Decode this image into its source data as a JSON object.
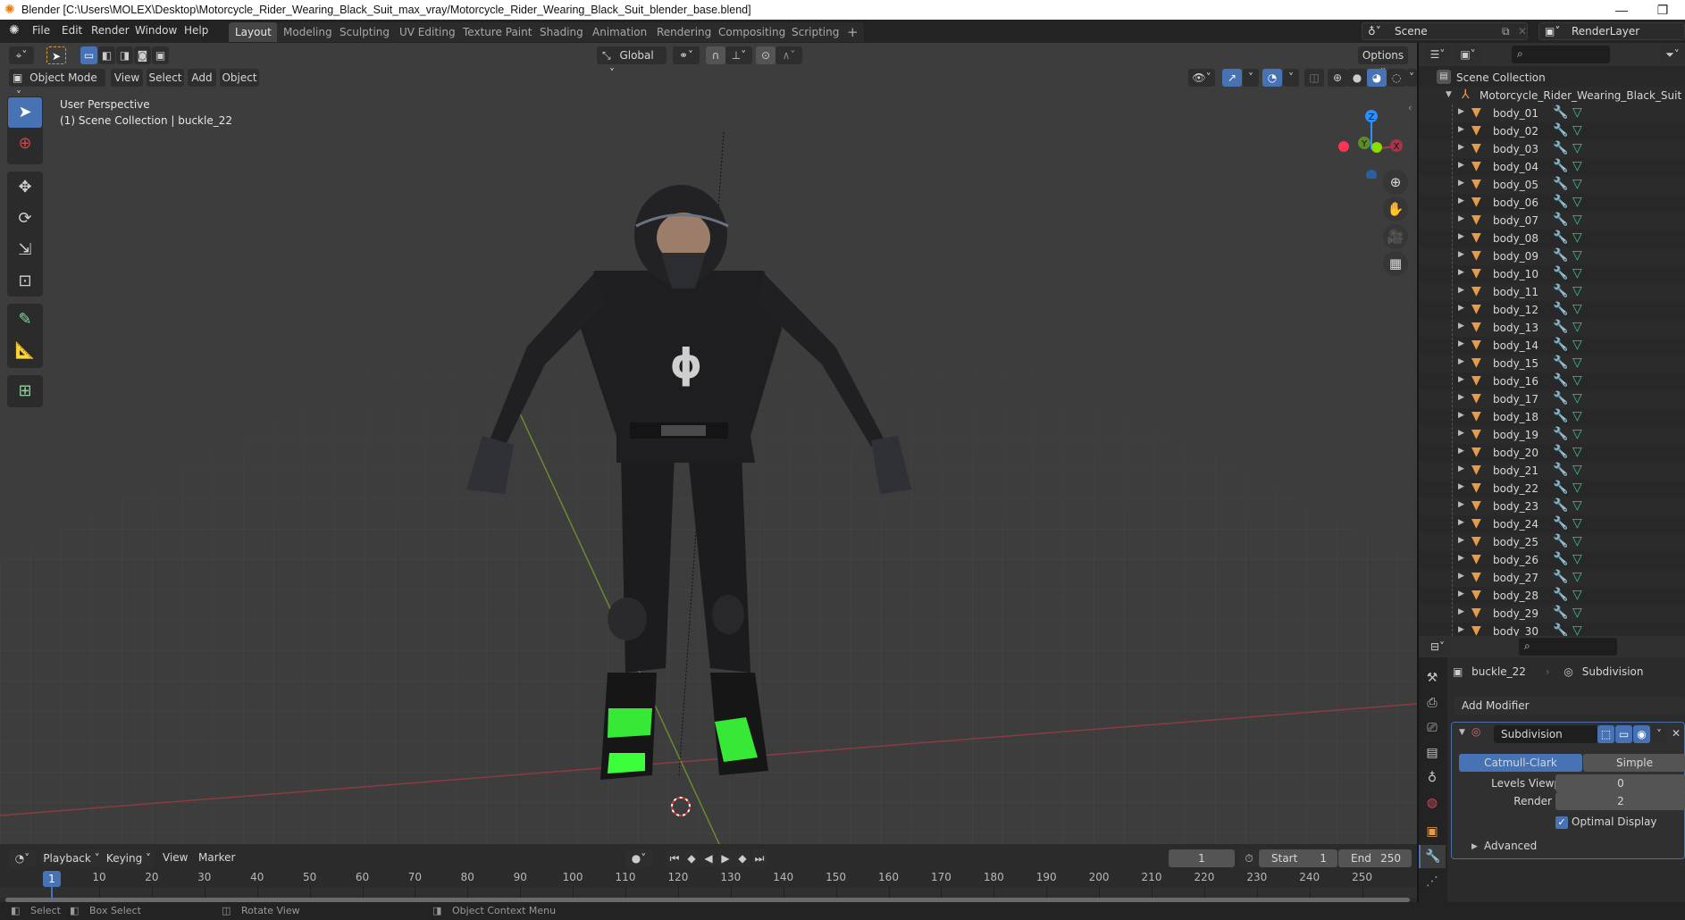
{
  "window": {
    "title": "Blender [C:\\Users\\MOLEX\\Desktop\\Motorcycle_Rider_Wearing_Black_Suit_max_vray/Motorcycle_Rider_Wearing_Black_Suit_blender_base.blend]",
    "minimize_label": "—",
    "maximize_label": "❐"
  },
  "menus": [
    "File",
    "Edit",
    "Render",
    "Window",
    "Help"
  ],
  "workspace_tabs": [
    {
      "label": "Layout",
      "active": true
    },
    {
      "label": "Modeling",
      "active": false
    },
    {
      "label": "Sculpting",
      "active": false
    },
    {
      "label": "UV Editing",
      "active": false
    },
    {
      "label": "Texture Paint",
      "active": false
    },
    {
      "label": "Shading",
      "active": false
    },
    {
      "label": "Animation",
      "active": false
    },
    {
      "label": "Rendering",
      "active": false
    },
    {
      "label": "Compositing",
      "active": false
    },
    {
      "label": "Scripting",
      "active": false
    }
  ],
  "add_workspace_label": "+",
  "scene": {
    "name": "Scene",
    "view_layer": "RenderLayer"
  },
  "viewport": {
    "transform_orientation": "Global",
    "options_label": "Options",
    "mode": "Object Mode",
    "header_menus": [
      "View",
      "Select",
      "Add",
      "Object"
    ],
    "overlay_title": "User Perspective",
    "overlay_subtitle": "(1) Scene Collection | buckle_22",
    "gizmo_axes": {
      "x": "X",
      "y": "Y",
      "z": "Z"
    },
    "colors": {
      "x_axis": "#ff3352",
      "y_axis": "#8bdc00",
      "z_axis": "#2890ff",
      "accent": "#4772b3",
      "background": "#3d3d3d"
    }
  },
  "outliner": {
    "root": "Scene Collection",
    "collection": "Motorcycle_Rider_Wearing_Black_Suit",
    "items": [
      "body_01",
      "body_02",
      "body_03",
      "body_04",
      "body_05",
      "body_06",
      "body_07",
      "body_08",
      "body_09",
      "body_10",
      "body_11",
      "body_12",
      "body_13",
      "body_14",
      "body_15",
      "body_16",
      "body_17",
      "body_18",
      "body_19",
      "body_20",
      "body_21",
      "body_22",
      "body_23",
      "body_24",
      "body_25",
      "body_26",
      "body_27",
      "body_28",
      "body_29",
      "body_30"
    ]
  },
  "properties": {
    "breadcrumb_object": "buckle_22",
    "breadcrumb_modifier": "Subdivision",
    "add_modifier_label": "Add Modifier",
    "modifier": {
      "name": "Subdivision",
      "type_options": [
        "Catmull-Clark",
        "Simple"
      ],
      "selected_type": "Catmull-Clark",
      "levels_viewport_label": "Levels Viewport",
      "levels_viewport": "0",
      "render_label": "Render",
      "render": "2",
      "optimal_display_label": "Optimal Display",
      "optimal_display": true,
      "advanced_label": "Advanced"
    }
  },
  "timeline": {
    "menus": [
      "Playback",
      "Keying",
      "View",
      "Marker"
    ],
    "current_frame": "1",
    "start_label": "Start",
    "start": "1",
    "end_label": "End",
    "end": "250",
    "ticks": [
      "10",
      "20",
      "30",
      "40",
      "50",
      "60",
      "70",
      "80",
      "90",
      "100",
      "110",
      "120",
      "130",
      "140",
      "150",
      "160",
      "170",
      "180",
      "190",
      "200",
      "210",
      "220",
      "230",
      "240",
      "250"
    ],
    "playhead_label": "1"
  },
  "statusbar": {
    "items": [
      "Select",
      "Box Select",
      "Rotate View",
      "Object Context Menu"
    ]
  }
}
